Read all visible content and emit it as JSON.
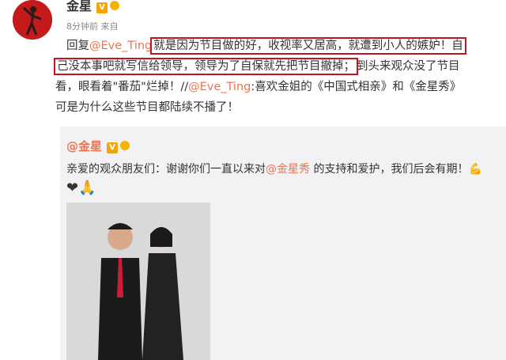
{
  "post": {
    "author": "金星",
    "verified_badge": "V",
    "meta": "8分钟前 来自",
    "line1": {
      "reply": "回复",
      "mention": "@Eve_Ting",
      "highlight": "就是因为节目做的好，收视率又居高，就遭到小人的嫉妒！自"
    },
    "line2": {
      "highlight": "己没本事吧就写信给领导，领导为了自保就先把节目撤掉；",
      "rest": "到头来观众没了节目"
    },
    "line3": {
      "pre": "看，眼看着\"番茄\"烂掉！//",
      "mention": "@Eve_Ting",
      "post": ":喜欢金姐的《中国式相亲》和《金星秀》"
    },
    "line4": "可是为什么这些节目都陆续不播了！"
  },
  "repost": {
    "author": "@金星",
    "text_pre": "亲爱的观众朋友们：谢谢你们一直以来对",
    "mention": "@金星秀",
    "text_post": " 的支持和爱护，我们后会有期！",
    "emoji_end": "💪",
    "emojis": "❤🙏"
  },
  "colors": {
    "link": "#eb7350",
    "highlight_box": "#c0161f",
    "badge": "#f7a400"
  },
  "icons": [
    "avatar-dancer-icon",
    "verified-icon",
    "medal-icon",
    "muscle-emoji",
    "heart-emoji",
    "pray-emoji"
  ]
}
